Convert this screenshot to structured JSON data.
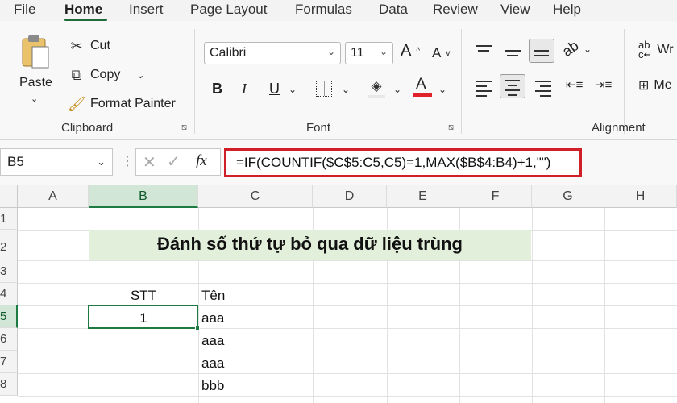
{
  "tabs": [
    "File",
    "Home",
    "Insert",
    "Page Layout",
    "Formulas",
    "Data",
    "Review",
    "View",
    "Help"
  ],
  "clipboard": {
    "paste": "Paste",
    "cut": "Cut",
    "copy": "Copy",
    "format_painter": "Format Painter",
    "group": "Clipboard"
  },
  "font": {
    "name": "Calibri",
    "size": "11",
    "group": "Font",
    "bold": "B",
    "italic": "I",
    "underline": "U",
    "font_color": "A",
    "grow": "A",
    "shrink": "A"
  },
  "alignment": {
    "group": "Alignment",
    "wrap_partial": "Wr",
    "merge_partial": "Me"
  },
  "formula_bar": {
    "name_box": "B5",
    "fx": "fx",
    "formula": "=IF(COUNTIF($C$5:C5,C5)=1,MAX($B$4:B4)+1,\"\")"
  },
  "columns": [
    "A",
    "B",
    "C",
    "D",
    "E",
    "F",
    "G",
    "H"
  ],
  "rows": [
    "1",
    "2",
    "3",
    "4",
    "5",
    "6",
    "7",
    "8"
  ],
  "sheet": {
    "title": "Đánh số thứ tự bỏ qua dữ liệu trùng",
    "header_stt": "STT",
    "header_ten": "Tên",
    "b5": "1",
    "c5": "aaa",
    "c6": "aaa",
    "c7": "aaa",
    "c8": "bbb"
  },
  "colors": {
    "accent_green": "#1d7a40",
    "title_fill": "#e2efda",
    "highlight_red": "#d01f26",
    "font_color_bar": "#e0202a"
  }
}
